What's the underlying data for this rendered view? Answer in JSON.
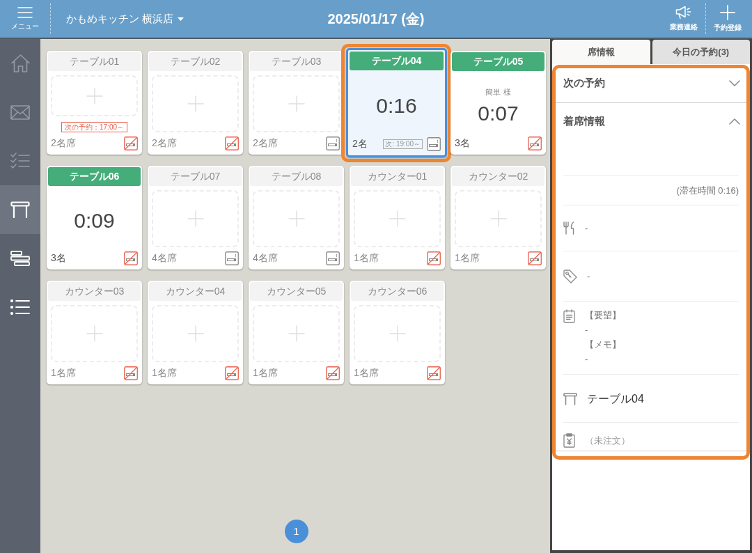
{
  "header": {
    "menu": {
      "label": "メニュー"
    },
    "store": {
      "name": "かもめキッチン 横浜店"
    },
    "date": "2025/01/17 (金)",
    "actions": [
      {
        "kind": "notice",
        "label": "業務連絡"
      },
      {
        "kind": "reserve",
        "label": "予約登録"
      }
    ]
  },
  "sidebar": {
    "items": [
      {
        "kind": "home",
        "selected": false,
        "disabled": true
      },
      {
        "kind": "mail",
        "selected": false,
        "disabled": true
      },
      {
        "kind": "tasks",
        "selected": false,
        "disabled": true
      },
      {
        "kind": "tables",
        "selected": true,
        "disabled": false
      },
      {
        "kind": "layout",
        "selected": false,
        "disabled": false
      },
      {
        "kind": "list",
        "selected": false,
        "disabled": false
      }
    ]
  },
  "tables": [
    {
      "kind": "vacant",
      "name": "テーブル01",
      "capacity": "2名席",
      "next_reservation": "次の予約：17:00～",
      "smoking": false,
      "selected": false,
      "highlighted": false
    },
    {
      "kind": "vacant",
      "name": "テーブル02",
      "capacity": "2名席",
      "smoking": false,
      "selected": false,
      "highlighted": false
    },
    {
      "kind": "vacant",
      "name": "テーブル03",
      "capacity": "2名席",
      "smoking": true,
      "selected": false,
      "highlighted": false
    },
    {
      "kind": "occupied",
      "name": "テーブル04",
      "time": "0:16",
      "guests": "2名",
      "next_reservation": "次: 19:00～",
      "smoking": true,
      "selected": true,
      "highlighted": true
    },
    {
      "kind": "occupied",
      "name": "テーブル05",
      "customer": "簡単 様",
      "time": "0:07",
      "guests": "3名",
      "smoking": false,
      "selected": false,
      "highlighted": false
    },
    {
      "kind": "occupied",
      "name": "テーブル06",
      "time": "0:09",
      "guests": "3名",
      "smoking": false,
      "selected": false,
      "highlighted": false
    },
    {
      "kind": "vacant",
      "name": "テーブル07",
      "capacity": "4名席",
      "smoking": true,
      "selected": false,
      "highlighted": false
    },
    {
      "kind": "vacant",
      "name": "テーブル08",
      "capacity": "4名席",
      "smoking": true,
      "selected": false,
      "highlighted": false
    },
    {
      "kind": "vacant",
      "name": "カウンター01",
      "capacity": "1名席",
      "smoking": false,
      "selected": false,
      "highlighted": false
    },
    {
      "kind": "vacant",
      "name": "カウンター02",
      "capacity": "1名席",
      "smoking": false,
      "selected": false,
      "highlighted": false
    },
    {
      "kind": "vacant",
      "name": "カウンター03",
      "capacity": "1名席",
      "smoking": false,
      "selected": false,
      "highlighted": false
    },
    {
      "kind": "vacant",
      "name": "カウンター04",
      "capacity": "1名席",
      "smoking": false,
      "selected": false,
      "highlighted": false
    },
    {
      "kind": "vacant",
      "name": "カウンター05",
      "capacity": "1名席",
      "smoking": false,
      "selected": false,
      "highlighted": false
    },
    {
      "kind": "vacant",
      "name": "カウンター06",
      "capacity": "1名席",
      "smoking": false,
      "selected": false,
      "highlighted": false
    }
  ],
  "pagination": [
    {
      "label": "1",
      "selected": true
    }
  ],
  "detail_panel": {
    "highlighted": true,
    "tabs": [
      {
        "label": "席情報",
        "selected": true
      },
      {
        "label": "今日の予約(3)",
        "selected": false
      }
    ],
    "sections": [
      {
        "title": "次の予約",
        "expanded": false
      },
      {
        "title": "着席情報",
        "expanded": true,
        "stay_time": "(滞在時間 0:16)",
        "rows": [
          {
            "kind": "course",
            "lines": [
              "-"
            ]
          },
          {
            "kind": "tag",
            "lines": [
              "-"
            ]
          },
          {
            "kind": "memo",
            "lines": [
              "【要望】",
              "-",
              "【メモ】",
              "-"
            ]
          },
          {
            "kind": "table",
            "lines": [
              "テーブル04"
            ]
          },
          {
            "kind": "order",
            "lines": [
              "（未注文）"
            ]
          }
        ]
      }
    ]
  }
}
